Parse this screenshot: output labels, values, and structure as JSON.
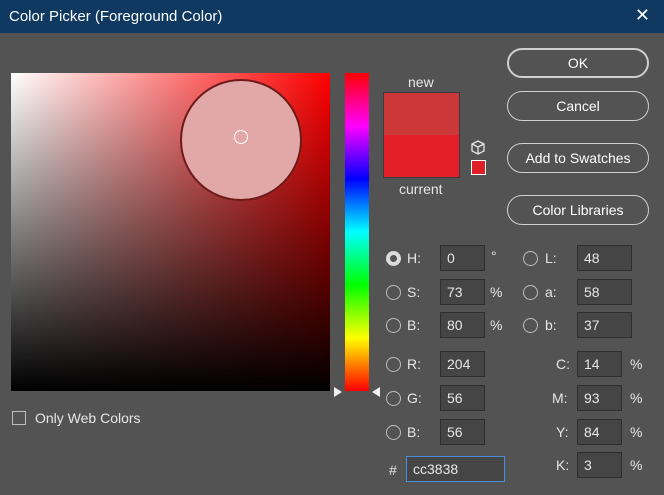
{
  "window": {
    "title": "Color Picker (Foreground Color)",
    "close_glyph": "✕"
  },
  "preview": {
    "new_label": "new",
    "current_label": "current",
    "new_color": "#cc3838",
    "current_color": "#e21f26"
  },
  "buttons": {
    "ok": "OK",
    "cancel": "Cancel",
    "add_to_swatches": "Add to Swatches",
    "color_libraries": "Color Libraries"
  },
  "fields": {
    "H": {
      "label": "H:",
      "value": "0",
      "unit": "°"
    },
    "S": {
      "label": "S:",
      "value": "73",
      "unit": "%"
    },
    "Bv": {
      "label": "B:",
      "value": "80",
      "unit": "%"
    },
    "R": {
      "label": "R:",
      "value": "204"
    },
    "G": {
      "label": "G:",
      "value": "56"
    },
    "Bc": {
      "label": "B:",
      "value": "56"
    },
    "L": {
      "label": "L:",
      "value": "48"
    },
    "a": {
      "label": "a:",
      "value": "58"
    },
    "b": {
      "label": "b:",
      "value": "37"
    },
    "C": {
      "label": "C:",
      "value": "14",
      "unit": "%"
    },
    "M": {
      "label": "M:",
      "value": "93",
      "unit": "%"
    },
    "Y": {
      "label": "Y:",
      "value": "84",
      "unit": "%"
    },
    "K": {
      "label": "K:",
      "value": "3",
      "unit": "%"
    },
    "hex": {
      "label": "#",
      "value": "cc3838"
    }
  },
  "web_colors": {
    "label": "Only Web Colors",
    "checked": false
  },
  "selected_mode": "H",
  "icons": {
    "close": "close-icon",
    "gamut": "cube-icon"
  }
}
